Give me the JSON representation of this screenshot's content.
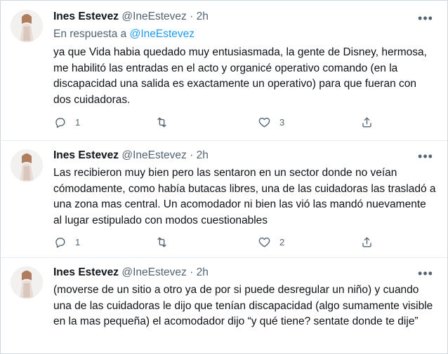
{
  "tweets": [
    {
      "name": "Ines Estevez",
      "handle": "@IneEstevez",
      "separator": "·",
      "time": "2h",
      "reply_prefix": "En respuesta a",
      "reply_to": "@IneEstevez",
      "text": "ya que Vida habia quedado muy entusiasmada, la gente de Disney, hermosa, me habilitó las entradas en el acto y organicé operativo comando (en la discapacidad una salida es exactamente un operativo) para que fueran con dos cuidadoras.",
      "reply_count": "1",
      "retweet_count": "",
      "like_count": "3"
    },
    {
      "name": "Ines Estevez",
      "handle": "@IneEstevez",
      "separator": "·",
      "time": "2h",
      "text": "Las recibieron muy bien pero las sentaron en un sector donde no veían cómodamente, como había butacas libres, una de las cuidadoras las trasladó a una zona mas central. Un acomodador ni bien las vió las mandó nuevamente al lugar estipulado con modos cuestionables",
      "reply_count": "1",
      "retweet_count": "",
      "like_count": "2"
    },
    {
      "name": "Ines Estevez",
      "handle": "@IneEstevez",
      "separator": "·",
      "time": "2h",
      "text": "(moverse de un sitio a otro ya de por si puede desregular un niño) y cuando una de las cuidadoras le dijo que tenían discapacidad (algo sumamente visible en la mas pequeña) el acomodador dijo “y qué tiene? sentate donde te dije”"
    }
  ],
  "icons": {
    "more": "more-dots-icon",
    "reply": "reply-bubble-icon",
    "retweet": "retweet-icon",
    "like": "heart-icon",
    "share": "share-icon"
  },
  "colors": {
    "text": "#0f1419",
    "secondary": "#536471",
    "link": "#1d9bf0",
    "separator": "#e6ecf0"
  }
}
